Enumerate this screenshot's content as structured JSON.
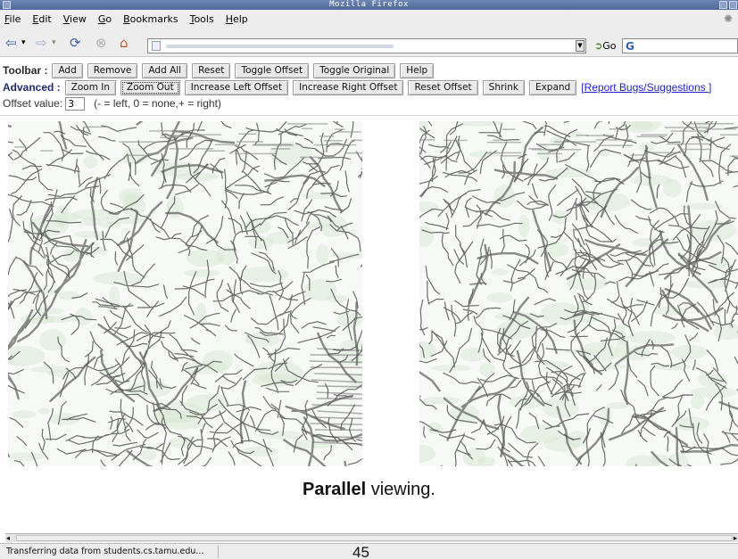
{
  "window": {
    "title": "Mozilla Firefox"
  },
  "menu": {
    "items": [
      {
        "accel": "F",
        "rest": "ile"
      },
      {
        "accel": "E",
        "rest": "dit"
      },
      {
        "accel": "V",
        "rest": "iew"
      },
      {
        "accel": "G",
        "rest": "o"
      },
      {
        "accel": "B",
        "rest": "ookmarks"
      },
      {
        "accel": "T",
        "rest": "ools"
      },
      {
        "accel": "H",
        "rest": "elp"
      }
    ]
  },
  "navigation": {
    "go_label": "Go",
    "icons": [
      "back-icon",
      "forward-icon",
      "reload-icon",
      "stop-icon",
      "home-icon"
    ]
  },
  "toolbar": {
    "label": "Toolbar :",
    "buttons": [
      "Add",
      "Remove",
      "Add All",
      "Reset",
      "Toggle Offset",
      "Toggle Original",
      "Help"
    ]
  },
  "advanced": {
    "label": "Advanced :",
    "buttons": [
      "Zoom In",
      "Zoom Out",
      "Increase Left Offset",
      "Increase Right Offset",
      "Reset Offset",
      "Shrink",
      "Expand"
    ],
    "link": "[Report Bugs/Suggestions ]"
  },
  "offset": {
    "label": "Offset value:",
    "value": "3",
    "hint": "(- = left, 0 = none,+ = right)"
  },
  "caption": {
    "bold": "Parallel",
    "rest": " viewing."
  },
  "status": {
    "message": "Transferring data from students.cs.tamu.edu..."
  },
  "page_number": "45",
  "colors": {
    "titlebar": "#5a72a6",
    "link": "#2222cc",
    "label_advanced": "#1d2d6b",
    "vessel": "#3d3d3d",
    "tissue_tint": "#d9e9d5"
  }
}
